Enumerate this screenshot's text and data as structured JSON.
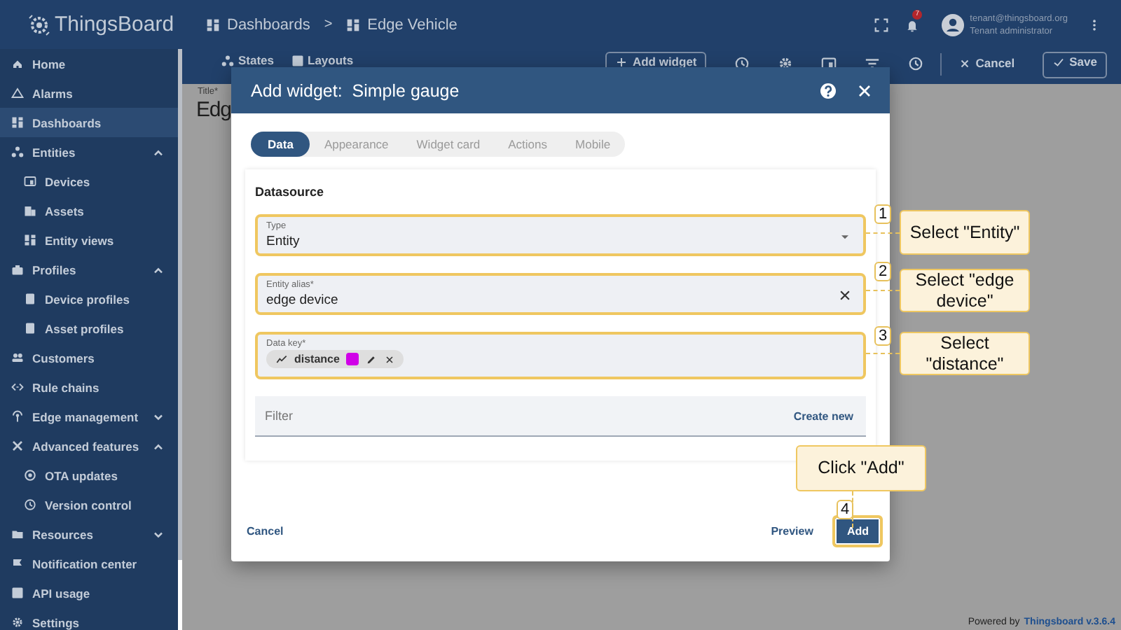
{
  "header": {
    "app_name": "ThingsBoard",
    "breadcrumbs": [
      "Dashboards",
      "Edge Vehicle"
    ],
    "separator": ">",
    "notification_count": "7",
    "user_email": "tenant@thingsboard.org",
    "user_role": "Tenant administrator"
  },
  "sidebar": {
    "items": [
      {
        "label": "Home",
        "selected": false
      },
      {
        "label": "Alarms",
        "selected": false
      },
      {
        "label": "Dashboards",
        "selected": true
      },
      {
        "label": "Entities",
        "selected": false,
        "expanded": true,
        "children": [
          {
            "label": "Devices",
            "selected": false
          },
          {
            "label": "Assets",
            "selected": false
          },
          {
            "label": "Entity views",
            "selected": false
          }
        ]
      },
      {
        "label": "Profiles",
        "selected": false,
        "expanded": true,
        "children": [
          {
            "label": "Device profiles",
            "selected": false
          },
          {
            "label": "Asset profiles",
            "selected": false
          }
        ]
      },
      {
        "label": "Customers",
        "selected": false
      },
      {
        "label": "Rule chains",
        "selected": false
      },
      {
        "label": "Edge management",
        "selected": false,
        "expanded": false
      },
      {
        "label": "Advanced features",
        "selected": false,
        "expanded": true,
        "children": [
          {
            "label": "OTA updates",
            "selected": false
          },
          {
            "label": "Version control",
            "selected": false
          }
        ]
      },
      {
        "label": "Resources",
        "selected": false,
        "expanded": false
      },
      {
        "label": "Notification center",
        "selected": false
      },
      {
        "label": "API usage",
        "selected": false
      },
      {
        "label": "Settings",
        "selected": false
      }
    ]
  },
  "toolbar": {
    "left": [
      "States",
      "Layouts"
    ],
    "add_widget": "Add widget",
    "cancel": "Cancel",
    "save": "Save"
  },
  "dashboard": {
    "title_label": "Title*",
    "title": "Edg"
  },
  "dialog": {
    "title": "Add widget:  Simple gauge",
    "tabs": [
      {
        "label": "Data",
        "selected": true
      },
      {
        "label": "Appearance",
        "selected": false
      },
      {
        "label": "Widget card",
        "selected": false
      },
      {
        "label": "Actions",
        "selected": false
      },
      {
        "label": "Mobile",
        "selected": false
      }
    ],
    "section": "Datasource",
    "fields": [
      {
        "kind": "select",
        "label": "Type",
        "value": "Entity",
        "highlighted": true
      },
      {
        "kind": "autocomplete",
        "label": "Entity alias*",
        "value": "edge device",
        "highlighted": true
      },
      {
        "kind": "chips",
        "label": "Data key*",
        "highlighted": true,
        "chips": [
          {
            "label": "distance",
            "color": "#d000e8"
          }
        ]
      },
      {
        "kind": "filter",
        "placeholder": "Filter",
        "action": "Create new",
        "highlighted": false
      }
    ],
    "buttons": [
      {
        "kind": "text",
        "label": "Cancel",
        "highlighted": false
      },
      {
        "kind": "text",
        "label": "Preview",
        "highlighted": false
      },
      {
        "kind": "primary",
        "label": "Add",
        "highlighted": true
      }
    ]
  },
  "annotations": [
    {
      "number": "1",
      "text": "Select \"Entity\""
    },
    {
      "number": "2",
      "text": "Select \"edge device\""
    },
    {
      "number": "3",
      "text": "Select \"distance\""
    },
    {
      "number": "4",
      "text": "Click \"Add\""
    }
  ],
  "footer": {
    "prefix": "Powered by",
    "link": "Thingsboard v.3.6.4"
  }
}
